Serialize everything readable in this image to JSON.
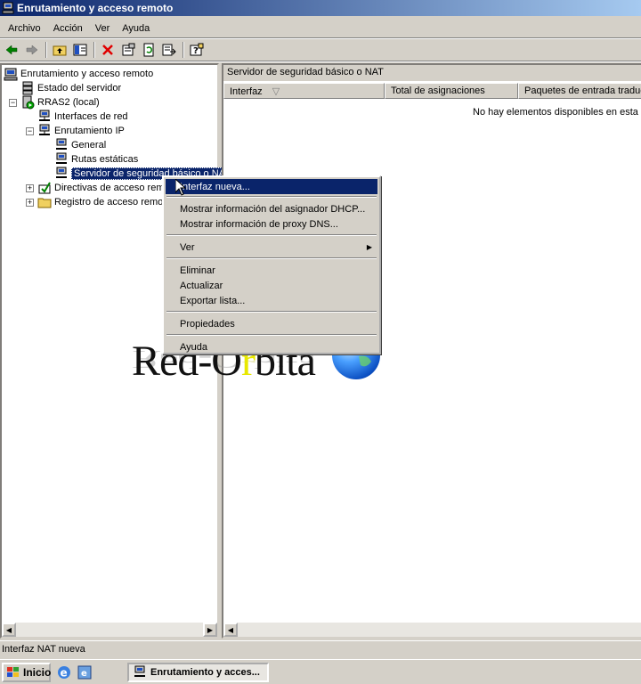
{
  "window": {
    "title": "Enrutamiento y acceso remoto"
  },
  "menu": [
    "Archivo",
    "Acción",
    "Ver",
    "Ayuda"
  ],
  "toolbar": {
    "icons": [
      "back-arrow-icon",
      "forward-arrow-icon",
      "up-folder-icon",
      "show-hide-tree-icon",
      "delete-icon",
      "properties-icon",
      "refresh-icon",
      "export-list-icon",
      "help-icon"
    ]
  },
  "tree": {
    "root": "Enrutamiento y acceso remoto",
    "server_status": "Estado del servidor",
    "server": "RRAS2 (local)",
    "network_interfaces": "Interfaces de red",
    "ip_routing": "Enrutamiento IP",
    "general": "General",
    "static_routes": "Rutas estáticas",
    "nat": "Servidor de seguridad básico o NA",
    "policies": "Directivas de acceso remo",
    "logging": "Registro de acceso remot"
  },
  "list": {
    "header": "Servidor de seguridad básico o NAT",
    "columns": [
      "Interfaz",
      "Total de asignaciones",
      "Paquetes de entrada traduc"
    ],
    "empty_message": "No hay elementos disponibles en esta vi"
  },
  "context_menu": {
    "items": [
      "Interfaz nueva...",
      "Mostrar información del asignador DHCP...",
      "Mostrar información de proxy DNS...",
      "Ver",
      "Eliminar",
      "Actualizar",
      "Exportar lista...",
      "Propiedades",
      "Ayuda"
    ]
  },
  "watermark": {
    "text": "Red-Orbita",
    "first": "Red-O",
    "highlight": "r",
    "rest": "bita"
  },
  "status": {
    "text": "Interfaz NAT nueva"
  },
  "taskbar": {
    "start_label": "Inicio",
    "task_label": "Enrutamiento y acces..."
  },
  "colors": {
    "titlebar": "#0a246a",
    "highlight": "#0a246a",
    "face": "#d4d0c8",
    "watermark_accent": "#e8e800"
  }
}
